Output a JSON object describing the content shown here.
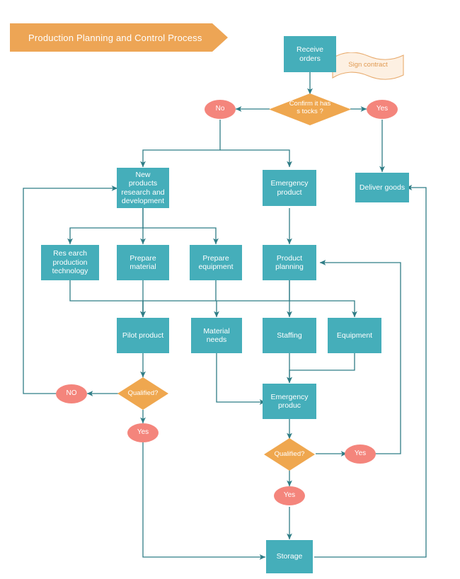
{
  "title_banner": {
    "text": "Production Planning and Control Process",
    "fill": "#eda555"
  },
  "palette": {
    "process_fill": "#45aeba",
    "decision_fill": "#efa74f",
    "terminal_fill": "#f4857c",
    "connector": "#2f7d86",
    "note_fill": "#fdf0e2",
    "note_border": "#e8ab6e",
    "text_on_shape": "#ffffff",
    "note_text": "#e09a52",
    "background": "#ffffff"
  },
  "note": {
    "text": "Sign contract"
  },
  "nodes": {
    "receive_orders": {
      "label": "Receive\norders",
      "type": "process"
    },
    "confirm_stocks": {
      "label": "Confirm it has\ns tocks ?",
      "type": "decision"
    },
    "stock_no": {
      "label": "No",
      "type": "terminal"
    },
    "stock_yes": {
      "label": "Yes",
      "type": "terminal"
    },
    "new_products_rd": {
      "label": "New\nproducts\nresearch and\ndevelopment",
      "type": "process"
    },
    "emergency_product": {
      "label": "Emergency\nproduct",
      "type": "process"
    },
    "deliver_goods": {
      "label": "Deliver goods",
      "type": "process"
    },
    "research_production_technology": {
      "label": "Res earch\nproduction\ntechnology",
      "type": "process"
    },
    "prepare_material": {
      "label": "Prepare\nmaterial",
      "type": "process"
    },
    "prepare_equipment": {
      "label": "Prepare\nequipment",
      "type": "process"
    },
    "product_planning": {
      "label": "Product\nplanning",
      "type": "process"
    },
    "pilot_product": {
      "label": "Pilot product",
      "type": "process"
    },
    "material_needs": {
      "label": "Material\nneeds",
      "type": "process"
    },
    "staffing": {
      "label": "Staffing",
      "type": "process"
    },
    "equipment": {
      "label": "Equipment",
      "type": "process"
    },
    "qualified_left": {
      "label": "Qualified?",
      "type": "decision"
    },
    "qualified_no": {
      "label": "NO",
      "type": "terminal"
    },
    "qualified_yes_left": {
      "label": "Yes",
      "type": "terminal"
    },
    "emergency_produc": {
      "label": "Emergency\nproduc",
      "type": "process"
    },
    "qualified_right": {
      "label": "Qualified?",
      "type": "decision"
    },
    "qualified_yes_right": {
      "label": "Yes",
      "type": "terminal"
    },
    "qualified_yes_down": {
      "label": "Yes",
      "type": "terminal"
    },
    "storage": {
      "label": "Storage",
      "type": "process"
    }
  }
}
